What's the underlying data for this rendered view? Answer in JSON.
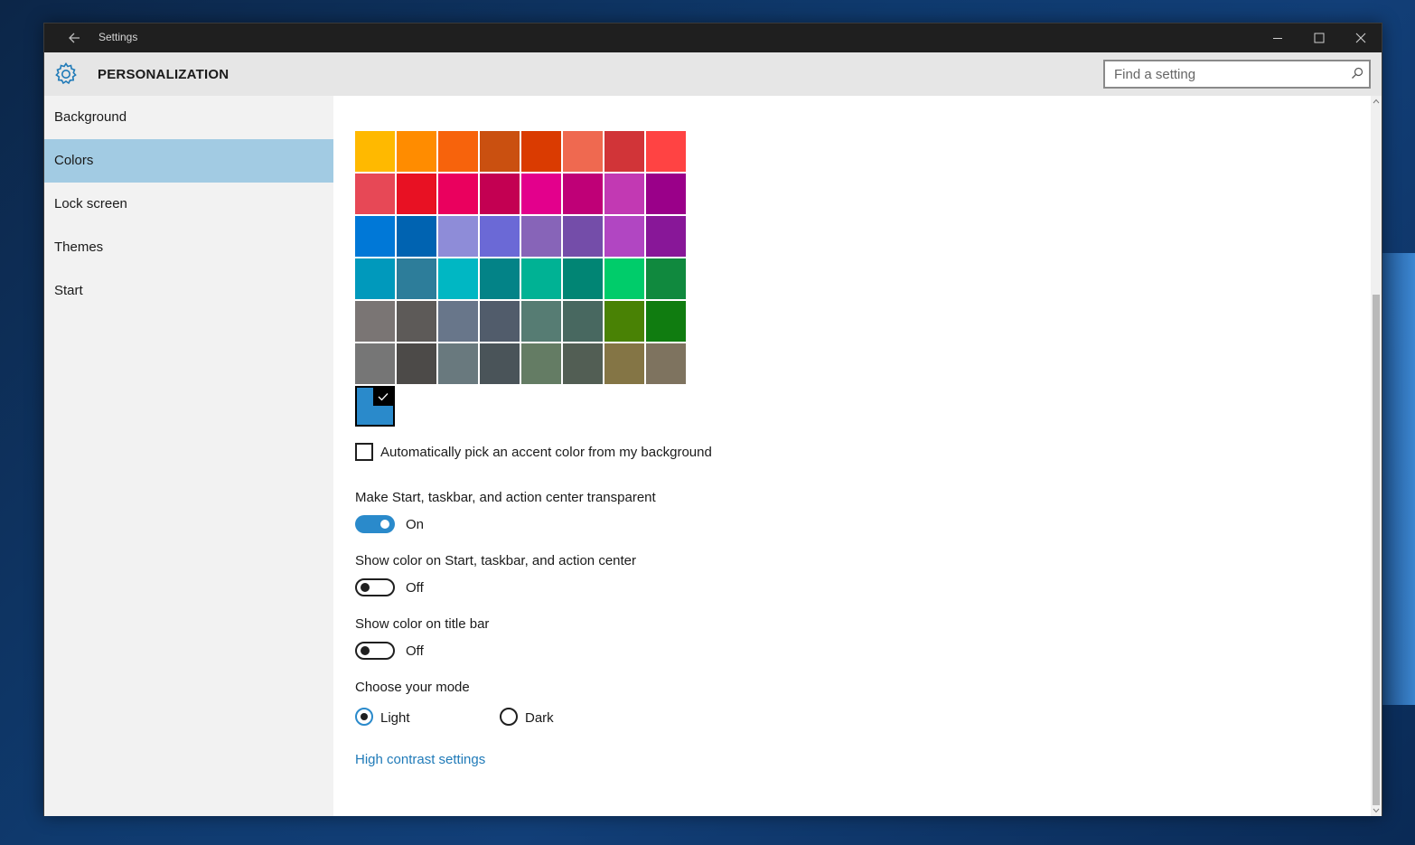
{
  "window": {
    "title": "Settings",
    "back_icon": "back-arrow-icon",
    "controls": [
      "minimize-icon",
      "maximize-icon",
      "close-icon"
    ]
  },
  "header": {
    "icon": "gear-icon",
    "title": "PERSONALIZATION",
    "search": {
      "placeholder": "Find a setting",
      "value": "",
      "icon": "search-icon"
    }
  },
  "sidebar": {
    "items": [
      {
        "label": "Background",
        "selected": false
      },
      {
        "label": "Colors",
        "selected": true
      },
      {
        "label": "Lock screen",
        "selected": false
      },
      {
        "label": "Themes",
        "selected": false
      },
      {
        "label": "Start",
        "selected": false
      }
    ]
  },
  "colors": {
    "accent_palette": [
      [
        "#FFB900",
        "#FF8C00",
        "#F7630C",
        "#CA5010",
        "#DA3B01",
        "#EF6950",
        "#D13438",
        "#FF4343"
      ],
      [
        "#E74856",
        "#E81123",
        "#EA005E",
        "#C30052",
        "#E3008C",
        "#BF0077",
        "#C239B3",
        "#9A0089"
      ],
      [
        "#0078D7",
        "#0063B1",
        "#8E8CD8",
        "#6B69D6",
        "#8764B8",
        "#744DA9",
        "#B146C2",
        "#881798"
      ],
      [
        "#0099BC",
        "#2D7D9A",
        "#00B7C3",
        "#038387",
        "#00B294",
        "#018574",
        "#00CC6A",
        "#10893E"
      ],
      [
        "#7A7574",
        "#5D5A58",
        "#68768A",
        "#515C6B",
        "#567C73",
        "#486860",
        "#498205",
        "#107C10"
      ],
      [
        "#767676",
        "#4C4A48",
        "#69797E",
        "#4A5459",
        "#647C64",
        "#525E54",
        "#847545",
        "#7E735F"
      ]
    ],
    "selected_color": "#2A8ACB",
    "selected_check_icon": "checkmark-icon",
    "auto_pick": {
      "label": "Automatically pick an accent color from my background",
      "checked": false
    },
    "toggles": [
      {
        "label": "Make Start, taskbar, and action center transparent",
        "state": "On",
        "on": true
      },
      {
        "label": "Show color on Start, taskbar, and action center",
        "state": "Off",
        "on": false
      },
      {
        "label": "Show color on title bar",
        "state": "Off",
        "on": false
      }
    ],
    "mode": {
      "label": "Choose your mode",
      "options": [
        {
          "label": "Light",
          "selected": true
        },
        {
          "label": "Dark",
          "selected": false
        }
      ]
    },
    "high_contrast_link": "High contrast settings",
    "accent_color": "#2A8ACB",
    "link_color": "#1F7AB8"
  }
}
